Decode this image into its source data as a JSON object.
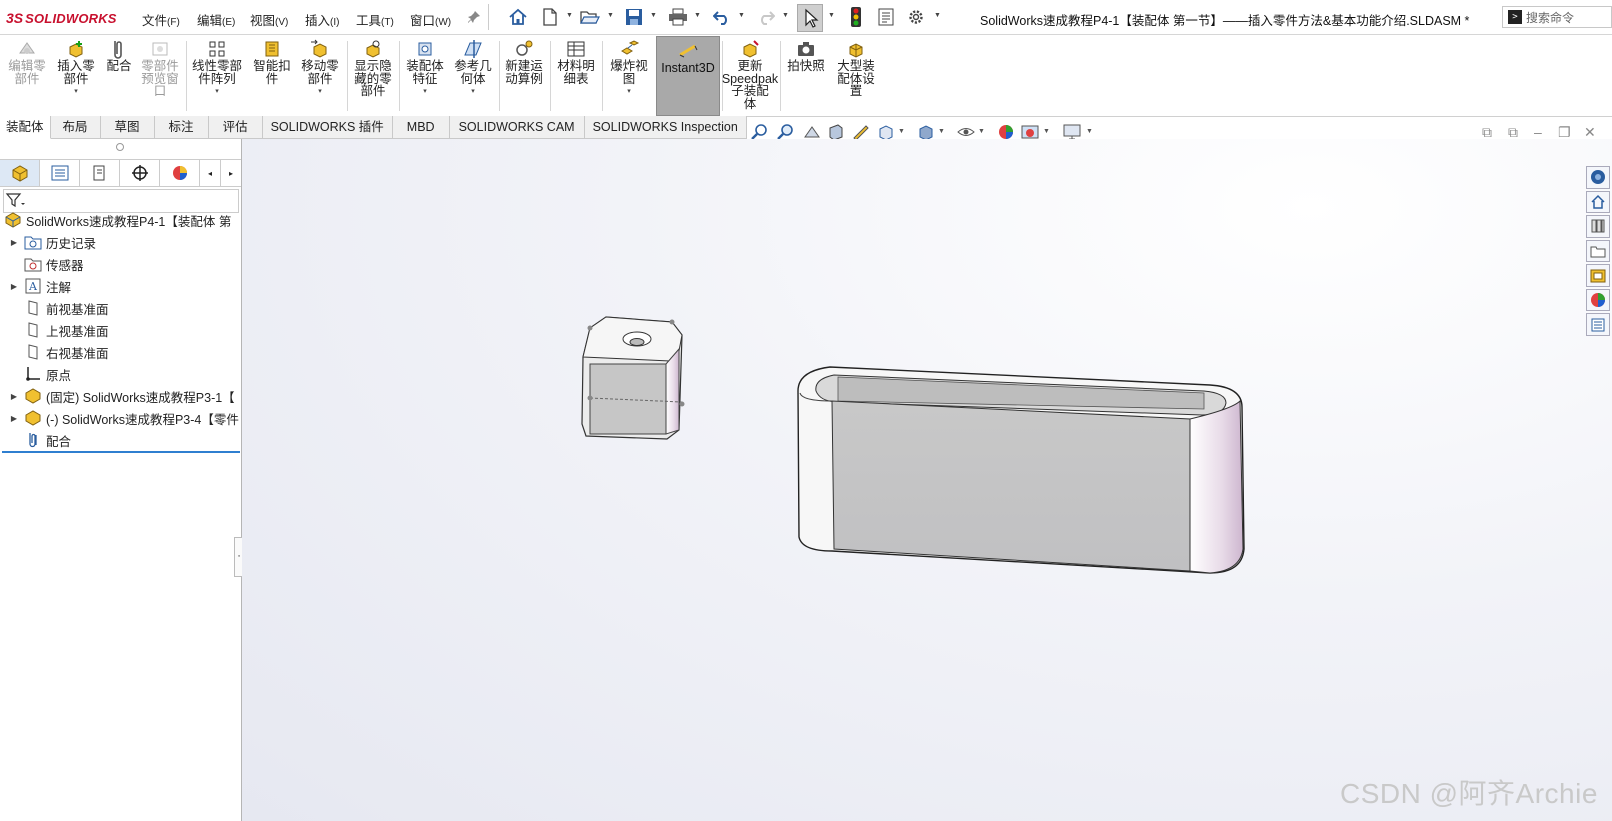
{
  "menu": {
    "logo_prefix": "3S",
    "logo_text": "SOLIDWORKS",
    "items": [
      {
        "label": "文件",
        "acc": "(F)"
      },
      {
        "label": "编辑",
        "acc": "(E)"
      },
      {
        "label": "视图",
        "acc": "(V)"
      },
      {
        "label": "插入",
        "acc": "(I)"
      },
      {
        "label": "工具",
        "acc": "(T)"
      },
      {
        "label": "窗口",
        "acc": "(W)"
      }
    ]
  },
  "window_title": "SolidWorks速成教程P4-1【装配体  第一节】——插入零件方法&基本功能介绍.SLDASM *",
  "search": {
    "placeholder": "搜索命令",
    "icon": "terminal-icon"
  },
  "ribbon": {
    "buttons": [
      {
        "label": "编辑零\n部件",
        "icon": "edit-component-icon",
        "disabled": true
      },
      {
        "label": "插入零\n部件",
        "icon": "insert-component-icon",
        "dropdown": "▾"
      },
      {
        "label": "配合",
        "icon": "mate-icon"
      },
      {
        "label": "零部件\n预览窗\n口",
        "icon": "component-preview-icon",
        "disabled": true
      },
      {
        "label": "线性零部\n件阵列",
        "icon": "linear-pattern-icon",
        "dropdown": "▾"
      },
      {
        "label": "智能扣\n件",
        "icon": "smart-fastener-icon"
      },
      {
        "label": "移动零\n部件",
        "icon": "move-component-icon",
        "dropdown": "▾"
      },
      {
        "label": "显示隐\n藏的零\n部件",
        "icon": "show-hidden-icon"
      },
      {
        "label": "装配体\n特征",
        "icon": "assembly-feature-icon",
        "dropdown": "▾"
      },
      {
        "label": "参考几\n何体",
        "icon": "reference-geometry-icon",
        "dropdown": "▾"
      },
      {
        "label": "新建运\n动算例",
        "icon": "motion-study-icon"
      },
      {
        "label": "材料明\n细表",
        "icon": "bom-icon"
      },
      {
        "label": "爆炸视\n图",
        "icon": "exploded-view-icon",
        "dropdown": "▾"
      },
      {
        "label": "Instant3D",
        "icon": "instant3d-icon",
        "active": true
      },
      {
        "label": "更新\nSpeedpak\n子装配\n体",
        "icon": "speedpak-icon"
      },
      {
        "label": "拍快照",
        "icon": "snapshot-icon"
      },
      {
        "label": "大型装\n配体设\n置",
        "icon": "large-assembly-icon"
      }
    ]
  },
  "tabs": [
    "装配体",
    "布局",
    "草图",
    "标注",
    "评估",
    "SOLIDWORKS 插件",
    "MBD",
    "SOLIDWORKS CAM",
    "SOLIDWORKS Inspection"
  ],
  "active_tab": "装配体",
  "tree": {
    "root": "SolidWorks速成教程P4-1【装配体  第",
    "items": [
      {
        "label": "历史记录",
        "icon": "history-folder-icon",
        "expandable": true
      },
      {
        "label": "传感器",
        "icon": "sensor-icon",
        "expandable": false
      },
      {
        "label": "注解",
        "icon": "annotation-icon",
        "expandable": true
      },
      {
        "label": "前视基准面",
        "icon": "plane-icon",
        "expandable": false
      },
      {
        "label": "上视基准面",
        "icon": "plane-icon",
        "expandable": false
      },
      {
        "label": "右视基准面",
        "icon": "plane-icon",
        "expandable": false
      },
      {
        "label": "原点",
        "icon": "origin-icon",
        "expandable": false
      },
      {
        "label": "(固定) SolidWorks速成教程P3-1【",
        "icon": "part-icon",
        "expandable": true
      },
      {
        "label": "(-) SolidWorks速成教程P3-4【零件",
        "icon": "part-icon",
        "expandable": true
      },
      {
        "label": "配合",
        "icon": "mates-folder-icon",
        "expandable": false
      }
    ]
  },
  "watermark": "CSDN @阿齐Archie",
  "colors": {
    "brand": "#c8102e",
    "panel_tab_active": "#dde8f5",
    "accent_line": "#2f7fd0",
    "active_button": "#a9a9a9"
  }
}
